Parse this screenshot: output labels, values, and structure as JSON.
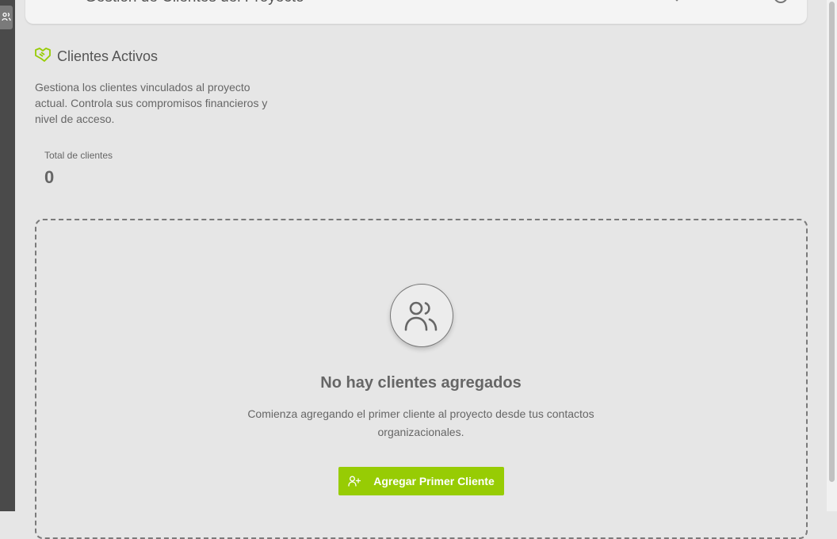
{
  "header": {
    "title": "Gestión de Clientes del Proyecto"
  },
  "section": {
    "title": "Clientes Activos",
    "description": "Gestiona los clientes vinculados al proyecto actual. Controla sus compromisos financieros y nivel de acceso."
  },
  "stats": {
    "total_label": "Total de clientes",
    "total_value": "0"
  },
  "empty_state": {
    "title": "No hay clientes agregados",
    "subtitle": "Comienza agregando el primer cliente al proyecto desde tus contactos organizacionales.",
    "button_label": "Agregar Primer Cliente",
    "icon": "users-icon"
  },
  "colors": {
    "accent": "#97cc04",
    "background": "#e6e6e6"
  }
}
